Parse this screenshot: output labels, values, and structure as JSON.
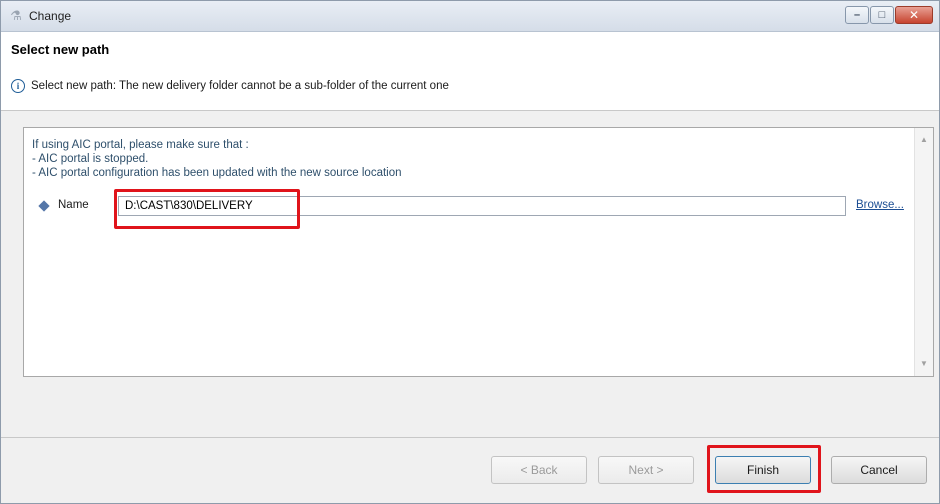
{
  "window": {
    "title": "Change",
    "icon": "wizard-icon",
    "controls": {
      "minimize": "–",
      "maximize": "□",
      "close": "✕"
    }
  },
  "header": {
    "title": "Select new path",
    "info_icon": "info-icon",
    "info_text": "Select new path: The new delivery folder cannot be a sub-folder of the current one"
  },
  "content": {
    "notice_lines": [
      "If using AIC portal, please make sure that :",
      "- AIC portal is stopped.",
      "- AIC portal configuration has been updated with the new source location"
    ],
    "name_label": "Name",
    "name_value": "D:\\CAST\\830\\DELIVERY",
    "browse_label": "Browse..."
  },
  "footer": {
    "back_label": "< Back",
    "next_label": "Next >",
    "finish_label": "Finish",
    "cancel_label": "Cancel"
  },
  "colors": {
    "highlight": "#e0141b",
    "link": "#1c4e93",
    "notice_text": "#2e4f6b"
  }
}
